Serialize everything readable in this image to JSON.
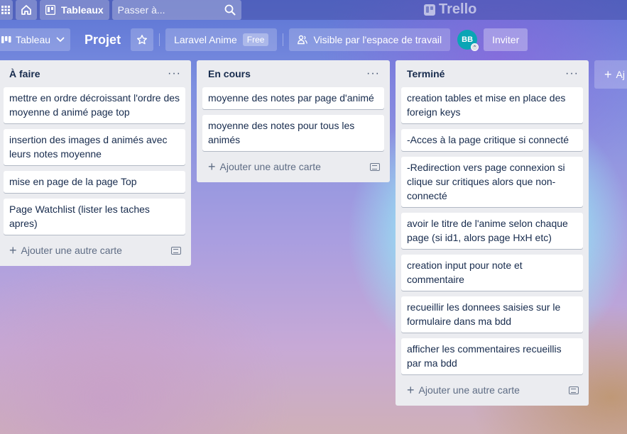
{
  "header": {
    "boards_label": "Tableaux",
    "search_placeholder": "Passer à...",
    "brand": "Trello"
  },
  "board": {
    "view_label": "Tableau",
    "title": "Projet",
    "workspace": "Laravel Anime",
    "workspace_plan": "Free",
    "visibility": "Visible par l'espace de travail",
    "avatar_initials": "BB",
    "invite_label": "Inviter"
  },
  "lists": [
    {
      "title": "À faire",
      "cards": [
        "mettre en ordre décroissant l'ordre des moyenne d animé page top",
        "insertion des images d animés avec leurs notes moyenne",
        "mise en page de la page Top",
        "Page Watchlist (lister les taches apres)"
      ],
      "add_label": "Ajouter une autre carte"
    },
    {
      "title": "En cours",
      "cards": [
        "moyenne des notes par page d'animé",
        "moyenne des notes pour tous les animés"
      ],
      "add_label": "Ajouter une autre carte"
    },
    {
      "title": "Terminé",
      "cards": [
        "creation tables et mise en place des foreign keys",
        "-Acces à la page critique si connecté",
        "-Redirection vers page connexion si clique sur critiques alors que non-connecté",
        "avoir le titre de l'anime selon chaque page (si id1, alors page HxH etc)",
        "creation input pour note et commentaire",
        "recueillir les donnees saisies sur le formulaire dans ma bdd",
        "afficher les commentaires recueillis par ma bdd"
      ],
      "add_label": "Ajouter une autre carte"
    }
  ],
  "add_list_label": "Aj"
}
